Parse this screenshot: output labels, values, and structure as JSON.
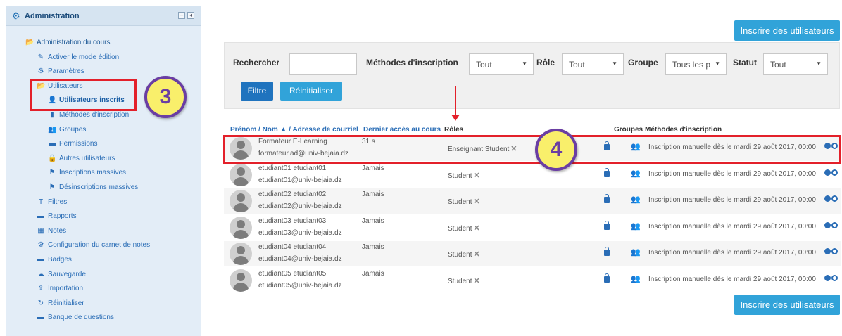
{
  "sidebar": {
    "title": "Administration",
    "items": [
      {
        "label": "Administration du cours",
        "icon": "folder-open-icon",
        "glyph": "📂"
      },
      {
        "label": "Activer le mode édition",
        "icon": "pencil-icon",
        "glyph": "✎"
      },
      {
        "label": "Paramètres",
        "icon": "gear-icon",
        "glyph": "⚙"
      },
      {
        "label": "Utilisateurs",
        "icon": "folder-open-icon",
        "glyph": "📂"
      },
      {
        "label": "Utilisateurs inscrits",
        "icon": "add-user-icon",
        "glyph": "👤"
      },
      {
        "label": "Méthodes d'inscription",
        "icon": "file-icon",
        "glyph": "▮"
      },
      {
        "label": "Groupes",
        "icon": "users-icon",
        "glyph": "👥"
      },
      {
        "label": "Permissions",
        "icon": "folder-icon",
        "glyph": "▬"
      },
      {
        "label": "Autres utilisateurs",
        "icon": "lock-icon",
        "glyph": "🔒"
      },
      {
        "label": "Inscriptions massives",
        "icon": "signpost-icon",
        "glyph": "⚑"
      },
      {
        "label": "Désinscriptions massives",
        "icon": "signpost-icon",
        "glyph": "⚑"
      },
      {
        "label": "Filtres",
        "icon": "filter-icon",
        "glyph": "T"
      },
      {
        "label": "Rapports",
        "icon": "folder-icon",
        "glyph": "▬"
      },
      {
        "label": "Notes",
        "icon": "table-icon",
        "glyph": "▦"
      },
      {
        "label": "Configuration du carnet de notes",
        "icon": "gear-icon",
        "glyph": "⚙"
      },
      {
        "label": "Badges",
        "icon": "folder-icon",
        "glyph": "▬"
      },
      {
        "label": "Sauvegarde",
        "icon": "cloud-icon",
        "glyph": "☁"
      },
      {
        "label": "Importation",
        "icon": "upload-icon",
        "glyph": "⇪"
      },
      {
        "label": "Réinitialiser",
        "icon": "refresh-icon",
        "glyph": "↻"
      },
      {
        "label": "Banque de questions",
        "icon": "folder-icon",
        "glyph": "▬"
      }
    ]
  },
  "callouts": {
    "step3": "3",
    "step4": "4"
  },
  "header": {
    "enrol_button": "Inscrire des utilisateurs"
  },
  "filters": {
    "search_label": "Rechercher",
    "search_value": "",
    "methods_label": "Méthodes d'inscription",
    "methods_value": "Tout",
    "role_label": "Rôle",
    "role_value": "Tout",
    "group_label": "Groupe",
    "group_value": "Tous les p",
    "status_label": "Statut",
    "status_value": "Tout",
    "filter_button": "Filtre",
    "reset_button": "Réinitialiser"
  },
  "table": {
    "col_name": "Prénom / Nom",
    "col_email": "/ Adresse de courriel",
    "col_last_access": "Dernier accès au cours",
    "col_roles": "Rôles",
    "col_groups": "Groupes",
    "col_methods": "Méthodes d'inscription",
    "rows": [
      {
        "name": "Formateur E-Learning",
        "email": "formateur.ad@univ-bejaia.dz",
        "last_access": "31 s",
        "roles": "Enseignant  Student",
        "method": "Inscription manuelle dès le mardi 29 août 2017, 00:00"
      },
      {
        "name": "etudiant01 etudiant01",
        "email": "etudiant01@univ-bejaia.dz",
        "last_access": "Jamais",
        "roles": "Student",
        "method": "Inscription manuelle dès le mardi 29 août 2017, 00:00"
      },
      {
        "name": "etudiant02 etudiant02",
        "email": "etudiant02@univ-bejaia.dz",
        "last_access": "Jamais",
        "roles": "Student",
        "method": "Inscription manuelle dès le mardi 29 août 2017, 00:00"
      },
      {
        "name": "etudiant03 etudiant03",
        "email": "etudiant03@univ-bejaia.dz",
        "last_access": "Jamais",
        "roles": "Student",
        "method": "Inscription manuelle dès le mardi 29 août 2017, 00:00"
      },
      {
        "name": "etudiant04 etudiant04",
        "email": "etudiant04@univ-bejaia.dz",
        "last_access": "Jamais",
        "roles": "Student",
        "method": "Inscription manuelle dès le mardi 29 août 2017, 00:00"
      },
      {
        "name": "etudiant05 etudiant05",
        "email": "etudiant05@univ-bejaia.dz",
        "last_access": "Jamais",
        "roles": "Student",
        "method": "Inscription manuelle dès le mardi 29 août 2017, 00:00"
      }
    ]
  },
  "footer": {
    "enrol_button": "Inscrire des utilisateurs"
  }
}
